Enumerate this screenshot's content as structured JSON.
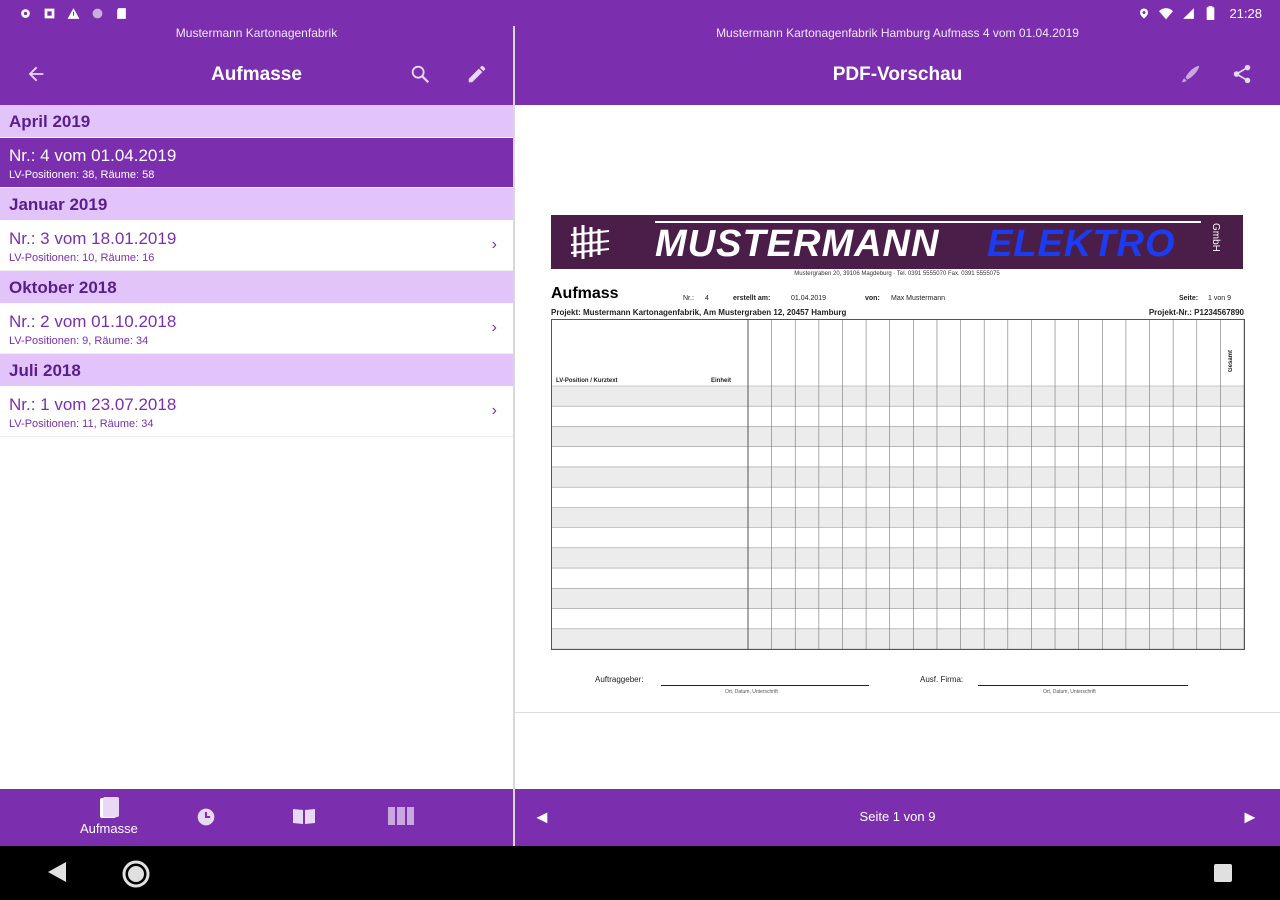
{
  "status_bar": {
    "time": "21:28",
    "left_icons": [
      "settings-icon",
      "storage-icon",
      "warning-icon",
      "circle-icon",
      "sd-card-icon"
    ],
    "right_icons": [
      "location-icon",
      "wifi-icon",
      "signal-icon",
      "battery-icon"
    ]
  },
  "left_pane": {
    "subtitle": "Mustermann Kartonagenfabrik",
    "title": "Aufmasse",
    "actions": [
      "back-icon",
      "search-icon",
      "edit-icon"
    ],
    "sections": [
      {
        "header": "April  2019",
        "items": [
          {
            "title": "Nr.: 4 vom 01.04.2019",
            "subtitle": "LV-Positionen: 38, Räume: 58",
            "selected": true
          }
        ]
      },
      {
        "header": "Januar  2019",
        "items": [
          {
            "title": "Nr.: 3 vom 18.01.2019",
            "subtitle": "LV-Positionen: 10, Räume: 16",
            "selected": false
          }
        ]
      },
      {
        "header": "Oktober  2018",
        "items": [
          {
            "title": "Nr.: 2 vom 01.10.2018",
            "subtitle": "LV-Positionen: 9, Räume: 34",
            "selected": false
          }
        ]
      },
      {
        "header": "Juli  2018",
        "items": [
          {
            "title": "Nr.: 1 vom 23.07.2018",
            "subtitle": "LV-Positionen: 11, Räume: 34",
            "selected": false
          }
        ]
      }
    ],
    "bottom_nav": [
      {
        "icon": "document-icon",
        "label": "Aufmasse",
        "active": true
      },
      {
        "icon": "clock-icon",
        "label": "",
        "active": false
      },
      {
        "icon": "book-icon",
        "label": "",
        "active": false
      },
      {
        "icon": "columns-icon",
        "label": "",
        "active": false
      }
    ]
  },
  "right_pane": {
    "subtitle": "Mustermann Kartonagenfabrik Hamburg Aufmass 4 vom 01.04.2019",
    "title": "PDF-Vorschau",
    "actions": [
      "brush-icon",
      "share-icon"
    ],
    "pager": {
      "text": "Seite 1 von 9",
      "prev": "◄",
      "next": "►"
    },
    "document": {
      "logo_text_1": "MUSTERMANN",
      "logo_text_2": "ELEKTRO",
      "logo_suffix": "GmbH",
      "address": "Mustergraben 20, 39106 Magdeburg · Tel. 0391 5555070 Fax. 0391 5555075",
      "heading": "Aufmass",
      "nr_label": "Nr.:",
      "nr_value": "4",
      "created_label": "erstellt am:",
      "created_value": "01.04.2019",
      "by_label": "von:",
      "by_value": "Max Mustermann",
      "page_label": "Seite:",
      "page_value": "1 von 9",
      "project": "Projekt: Mustermann Kartonagenfabrik, Am Mustergraben 12, 20457 Hamburg",
      "project_nr": "Projekt-Nr.: P1234567890",
      "table_header_position": "LV-Position / Kurztext",
      "table_header_unit": "Einheit",
      "table_header_total": "Gesamt",
      "signature_left": "Auftraggeber:",
      "signature_left_sub": "Ort, Datum, Unterschrift",
      "signature_right": "Ausf. Firma:",
      "signature_right_sub": "Ort, Datum, Unterschrift"
    }
  },
  "colors": {
    "primary": "#7b2fae",
    "section_bg": "#e2c4fb",
    "logo_bg": "#4b1e4a",
    "logo_blue": "#1b3cf0"
  }
}
